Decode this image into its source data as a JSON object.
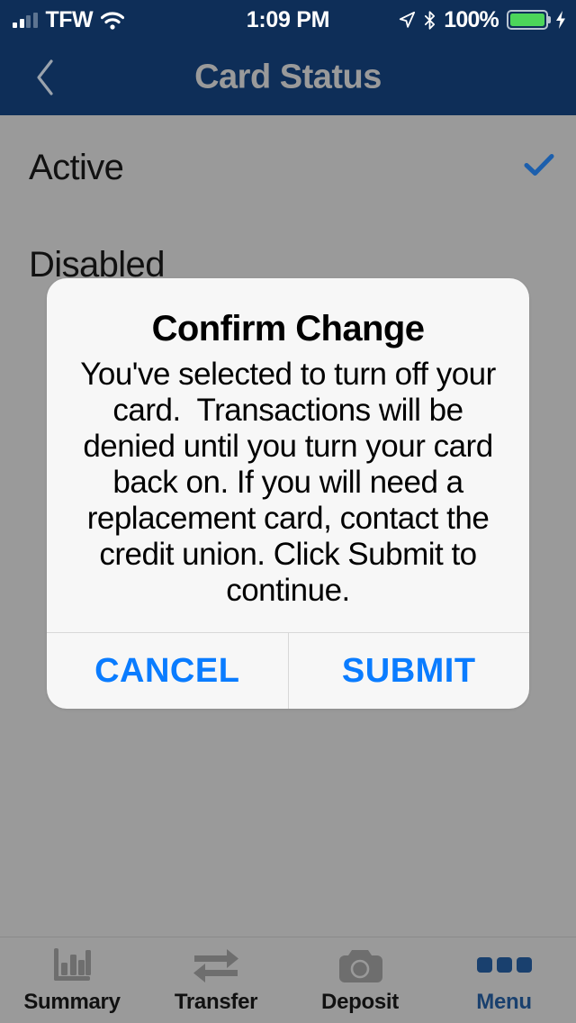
{
  "status_bar": {
    "carrier": "TFW",
    "time": "1:09 PM",
    "battery_percent": "100%",
    "icons": {
      "signal": "signal-bars-icon",
      "wifi": "wifi-icon",
      "location": "location-arrow-icon",
      "bluetooth": "bluetooth-icon",
      "battery": "battery-icon",
      "charging": "charging-bolt-icon"
    },
    "signal_bars_filled": 2,
    "signal_bars_total": 4,
    "battery_color": "#4cd55a"
  },
  "nav": {
    "title": "Card Status",
    "back_icon": "chevron-left-icon",
    "background": "#0e2e58",
    "title_color": "#9a9a9a"
  },
  "card_status": {
    "options": [
      {
        "label": "Active",
        "selected": true
      },
      {
        "label": "Disabled",
        "selected": false
      }
    ],
    "check_icon": "checkmark-icon",
    "check_color": "#1c5fad"
  },
  "dialog": {
    "title": "Confirm Change",
    "message": "You've selected to turn off your card.  Transactions will be denied until you turn your card back on. If you will need a replacement card, contact the credit union. Click Submit to continue.",
    "cancel_label": "CANCEL",
    "submit_label": "SUBMIT",
    "button_color": "#0a7cff",
    "background": "#f7f7f7"
  },
  "tab_bar": {
    "items": [
      {
        "label": "Summary",
        "icon": "bar-chart-icon",
        "active": false
      },
      {
        "label": "Transfer",
        "icon": "transfer-arrows-icon",
        "active": false
      },
      {
        "label": "Deposit",
        "icon": "camera-icon",
        "active": false
      },
      {
        "label": "Menu",
        "icon": "three-dots-icon",
        "active": true
      }
    ],
    "active_color": "#19406e",
    "inactive_color": "#111111",
    "icon_color": "#6e6e6e"
  },
  "overlay": {
    "dim_color": "#9a9a9a"
  }
}
